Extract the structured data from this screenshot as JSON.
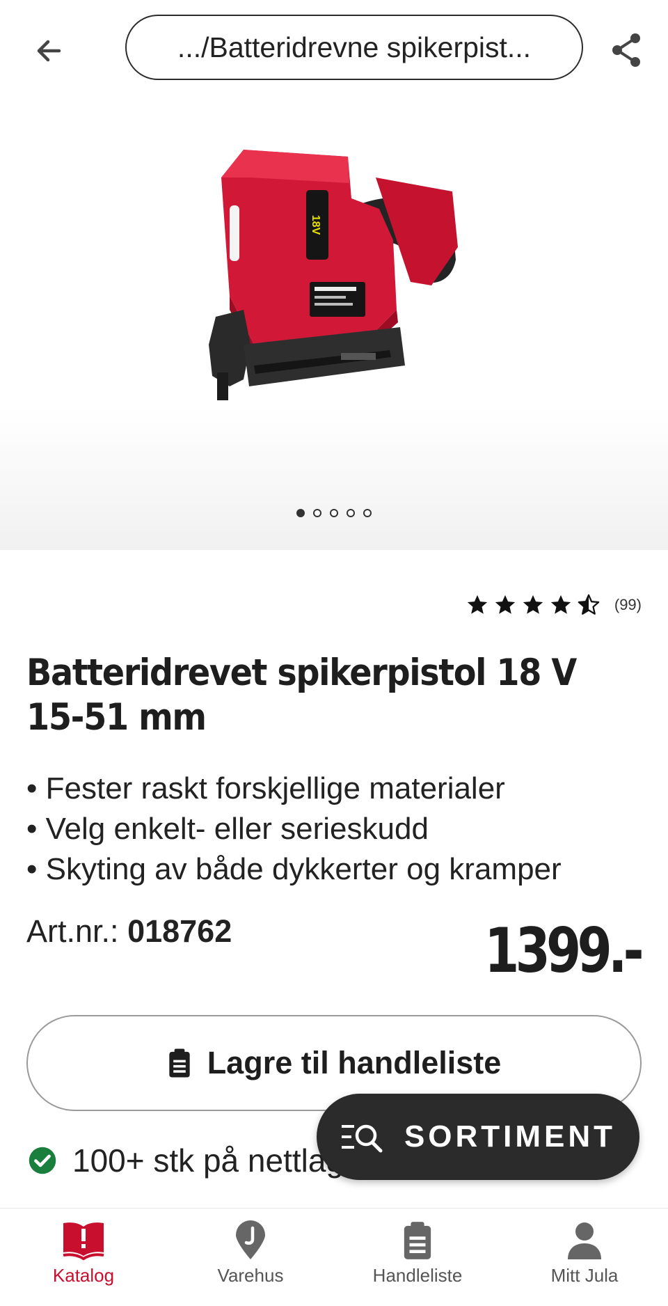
{
  "header": {
    "breadcrumb": ".../Batteridrevne spikerpist...",
    "back_icon": "arrow-left-icon",
    "share_icon": "share-icon"
  },
  "gallery": {
    "image_label": "product photo: red and black cordless nail gun",
    "image_label_text": "18V",
    "slide_count": 5,
    "active_slide": 1
  },
  "rating": {
    "stars": 4.5,
    "count": "(99)"
  },
  "product": {
    "title": "Batteridrevet spikerpistol 18 V 15-51 mm",
    "bullets": [
      "Fester raskt forskjellige materialer",
      "Velg enkelt- eller serieskudd",
      "Skyting av både dykkerter og kramper"
    ],
    "art_label": "Art.nr.:",
    "art_number": "018762",
    "price": "1399.-"
  },
  "actions": {
    "save_label": "Lagre til handleliste",
    "save_icon": "clipboard-icon"
  },
  "stock": {
    "text": "100+ stk på nettlager",
    "icon": "check-circle-icon"
  },
  "fab": {
    "label": "SORTIMENT",
    "icon": "list-search-icon"
  },
  "nav": {
    "items": [
      {
        "label": "Katalog",
        "icon": "catalog-book-icon",
        "active": true
      },
      {
        "label": "Varehus",
        "icon": "location-pin-icon",
        "active": false
      },
      {
        "label": "Handleliste",
        "icon": "clipboard-icon",
        "active": false
      },
      {
        "label": "Mitt Jula",
        "icon": "user-icon",
        "active": false
      }
    ]
  },
  "colors": {
    "accent": "#c8102e",
    "dark": "#2b2b2b",
    "stock_green": "#1a7f3c"
  }
}
